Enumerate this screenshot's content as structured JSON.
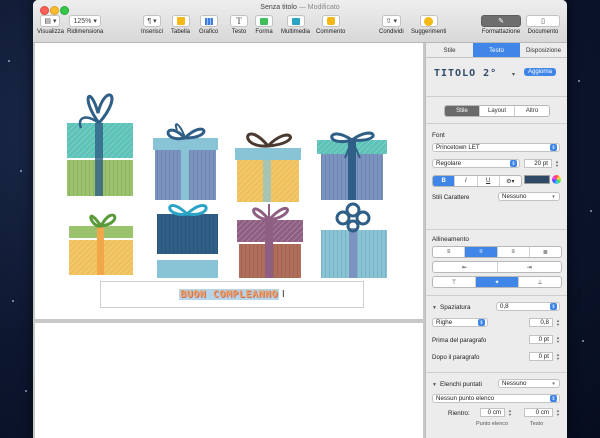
{
  "window": {
    "title": "Senza titolo",
    "status": "— Modificato"
  },
  "toolbar": {
    "view_label": "Visualizza",
    "zoom_value": "125%",
    "zoom_label": "Ridimensiona",
    "insert_label": "Inserisci",
    "table_label": "Tabella",
    "chart_label": "Grafico",
    "text_label": "Testo",
    "shape_label": "Forma",
    "media_label": "Multimedia",
    "comment_label": "Commento",
    "share_label": "Condividi",
    "tips_label": "Suggerimenti",
    "format_label": "Formattazione",
    "document_label": "Documento"
  },
  "canvas": {
    "caption_text": "BUON COMPLEANNO",
    "gift_colors": {
      "teal": "#5dc3b8",
      "green": "#9bc36d",
      "blue": "#7b93c0",
      "yellow": "#f0c15a",
      "navy": "#2f5f86",
      "mauve": "#8f5f83",
      "lightblue": "#88c4d6",
      "rust": "#b06e5a"
    }
  },
  "inspector": {
    "tabs": [
      "Stile",
      "Testo",
      "Disposizione"
    ],
    "active_tab": "Testo",
    "para_style": "TITOLO 2°",
    "update_button": "Aggiorna",
    "subtabs": [
      "Stile",
      "Layout",
      "Altro"
    ],
    "font": {
      "header": "Font",
      "family": "Princetown LET",
      "typeface": "Regolare",
      "size": "20 pt",
      "bold": "B",
      "italic": "I",
      "underline": "U",
      "char_styles_label": "Stili Carattere",
      "char_styles_value": "Nessuno"
    },
    "alignment": {
      "header": "Allineamento"
    },
    "spacing": {
      "header": "Spaziatura",
      "value": "0,8",
      "mode": "Righe",
      "mode_value": "0,8",
      "before_label": "Prima del paragrafo",
      "before_value": "0 pt",
      "after_label": "Dopo il paragrafo",
      "after_value": "0 pt"
    },
    "bullets": {
      "header": "Elenchi puntati",
      "value": "Nessuno",
      "bullet_type": "Nessun punto elenco",
      "indent_label": "Rientro:",
      "bullet_indent": "0 cm",
      "text_indent": "0 cm",
      "bullet_col": "Punto elenco",
      "text_col": "Testo"
    },
    "accent_color": "#3f86e8",
    "text_color": "#2e4a66"
  }
}
